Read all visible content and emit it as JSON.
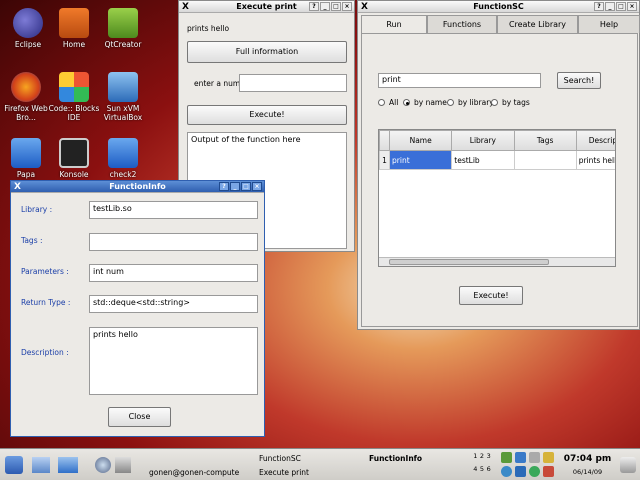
{
  "desktop": {
    "icons": [
      {
        "label": "Eclipse"
      },
      {
        "label": "Home"
      },
      {
        "label": "QtCreator"
      },
      {
        "label": "Firefox Web Bro..."
      },
      {
        "label": "Code:: Blocks IDE"
      },
      {
        "label": "Sun xVM VirtualBox"
      },
      {
        "label": "Papa"
      },
      {
        "label": "Konsole"
      },
      {
        "label": "check2"
      }
    ]
  },
  "execute_window": {
    "title": "Execute print",
    "function_label": "prints hello",
    "full_info_button": "Full information",
    "num_label": "enter a num",
    "num_value": "",
    "execute_button": "Execute!",
    "output_text": "Output of the function here"
  },
  "functionsc_window": {
    "title": "FunctionSC",
    "tabs": [
      "Run",
      "Functions",
      "Create Library",
      "Help"
    ],
    "search_value": "print",
    "search_button": "Search!",
    "radios": [
      {
        "label": "All",
        "checked": false
      },
      {
        "label": "by name",
        "checked": true
      },
      {
        "label": "by library",
        "checked": false
      },
      {
        "label": "by tags",
        "checked": false
      }
    ],
    "table": {
      "columns": [
        "Name",
        "Library",
        "Tags",
        "Descrip"
      ],
      "rows": [
        {
          "num": "1",
          "name": "print",
          "library": "testLib",
          "tags": "",
          "desc": "prints hello"
        }
      ]
    },
    "execute_button": "Execute!"
  },
  "functioninfo_window": {
    "title": "FunctionInfo",
    "library_label": "Library :",
    "library_value": "testLib.so",
    "tags_label": "Tags :",
    "tags_value": "",
    "params_label": "Parameters :",
    "params_value": "int num",
    "return_label": "Return Type :",
    "return_value": "std::deque<std::string>",
    "desc_label": "Description :",
    "desc_value": "prints hello",
    "close_button": "Close"
  },
  "taskbar": {
    "tasks": [
      {
        "label": "FunctionSC"
      },
      {
        "label": "FunctionInfo"
      },
      {
        "label": "gonen@gonen-compute"
      },
      {
        "label": "Execute print"
      }
    ],
    "pager": [
      "1",
      "2",
      "3",
      "4",
      "5",
      "6"
    ],
    "clock_time": "07:04 pm",
    "clock_date": "06/14/09"
  },
  "colors": {
    "titlebar_active": "#2f5fb0",
    "selection": "#3a6fd8"
  }
}
